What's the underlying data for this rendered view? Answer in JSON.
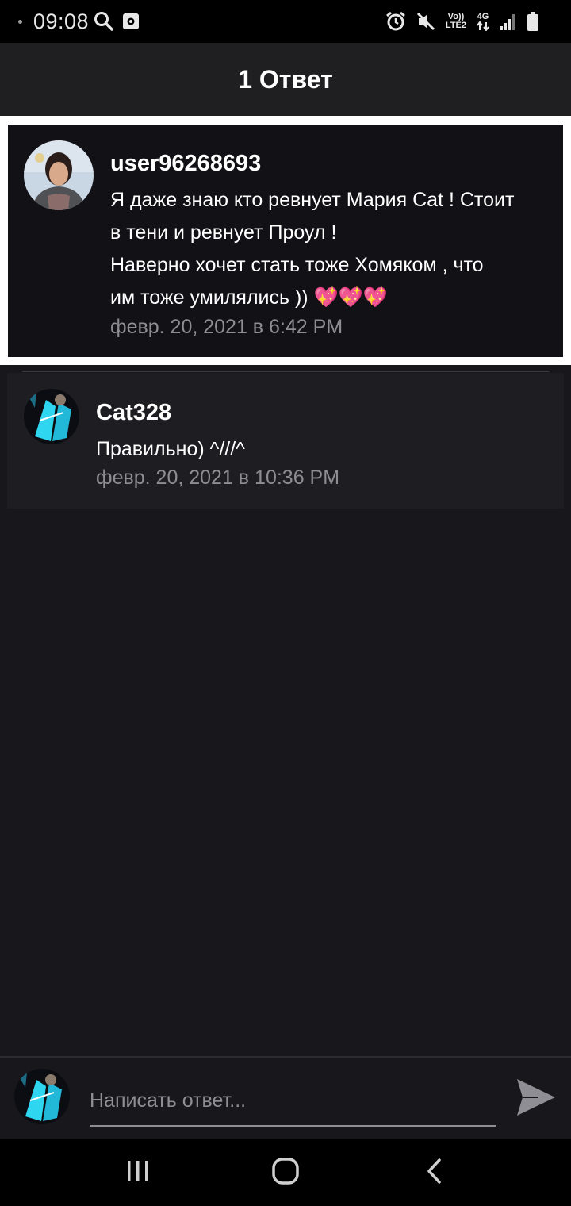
{
  "status_bar": {
    "time": "09:08",
    "left_icons": [
      "search-icon",
      "screenshot-icon"
    ],
    "right_icons": [
      "alarm-icon",
      "mute-icon",
      "volte-icon",
      "data-4g-icon",
      "signal-icon",
      "battery-icon"
    ],
    "volte_label_top": "Vo))",
    "volte_label_bottom": "LTE2",
    "network_label": "4G"
  },
  "header": {
    "title": "1 Ответ"
  },
  "original_comment": {
    "author": "user96268693",
    "text_lines": [
      "Я даже знаю кто ревнует Мария Cat ! Стоит",
      "в тени и ревнует Проул !",
      "Наверно хочет стать тоже Хомяком , что",
      "им тоже умилялись )) 💖💖💖"
    ],
    "date": "февр. 20, 2021 в 6:42 PM",
    "highlighted": true
  },
  "replies": [
    {
      "author": "Cat328",
      "text": "Правильно) ^///^",
      "date": "февр. 20, 2021 в 10:36 PM"
    }
  ],
  "compose": {
    "placeholder": "Написать ответ...",
    "value": "",
    "send_icon": "send-icon"
  },
  "nav_bar": {
    "buttons": [
      "recent-apps-icon",
      "home-icon",
      "back-icon"
    ]
  },
  "colors": {
    "background": "#18171c",
    "header": "#1f1f21",
    "highlight_border": "#ffffff",
    "secondary_text": "#8e8d93",
    "accent_cyan": "#2fd6f0"
  }
}
